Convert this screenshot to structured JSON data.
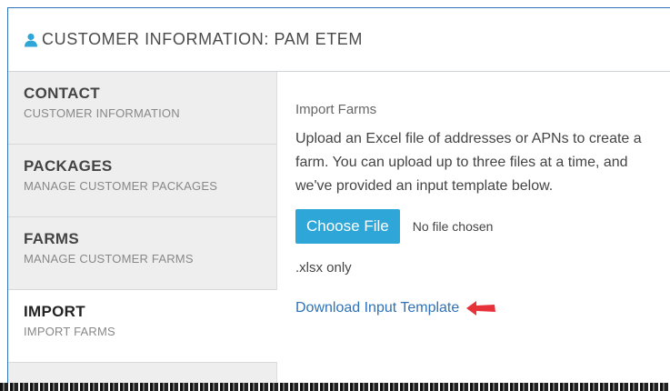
{
  "header": {
    "title": "CUSTOMER INFORMATION: PAM ETEM",
    "icon": "user-icon",
    "icon_color": "#2ea6d8"
  },
  "sidebar": {
    "items": [
      {
        "title": "CONTACT",
        "subtitle": "CUSTOMER INFORMATION",
        "active": false
      },
      {
        "title": "PACKAGES",
        "subtitle": "MANAGE CUSTOMER PACKAGES",
        "active": false
      },
      {
        "title": "FARMS",
        "subtitle": "MANAGE CUSTOMER FARMS",
        "active": false
      },
      {
        "title": "IMPORT",
        "subtitle": "IMPORT FARMS",
        "active": true
      }
    ]
  },
  "main": {
    "section_title": "Import Farms",
    "description": "Upload an Excel file of addresses or APNs to create a farm. You can upload up to three files at a time, and we've provided an input template below.",
    "choose_file_label": "Choose File",
    "no_file_text": "No file chosen",
    "extension_note": ".xlsx only",
    "download_link": "Download Input Template"
  },
  "colors": {
    "accent": "#2ea6d8",
    "link": "#2f72b5",
    "arrow": "#e8323a",
    "border": "#2e73b8"
  }
}
